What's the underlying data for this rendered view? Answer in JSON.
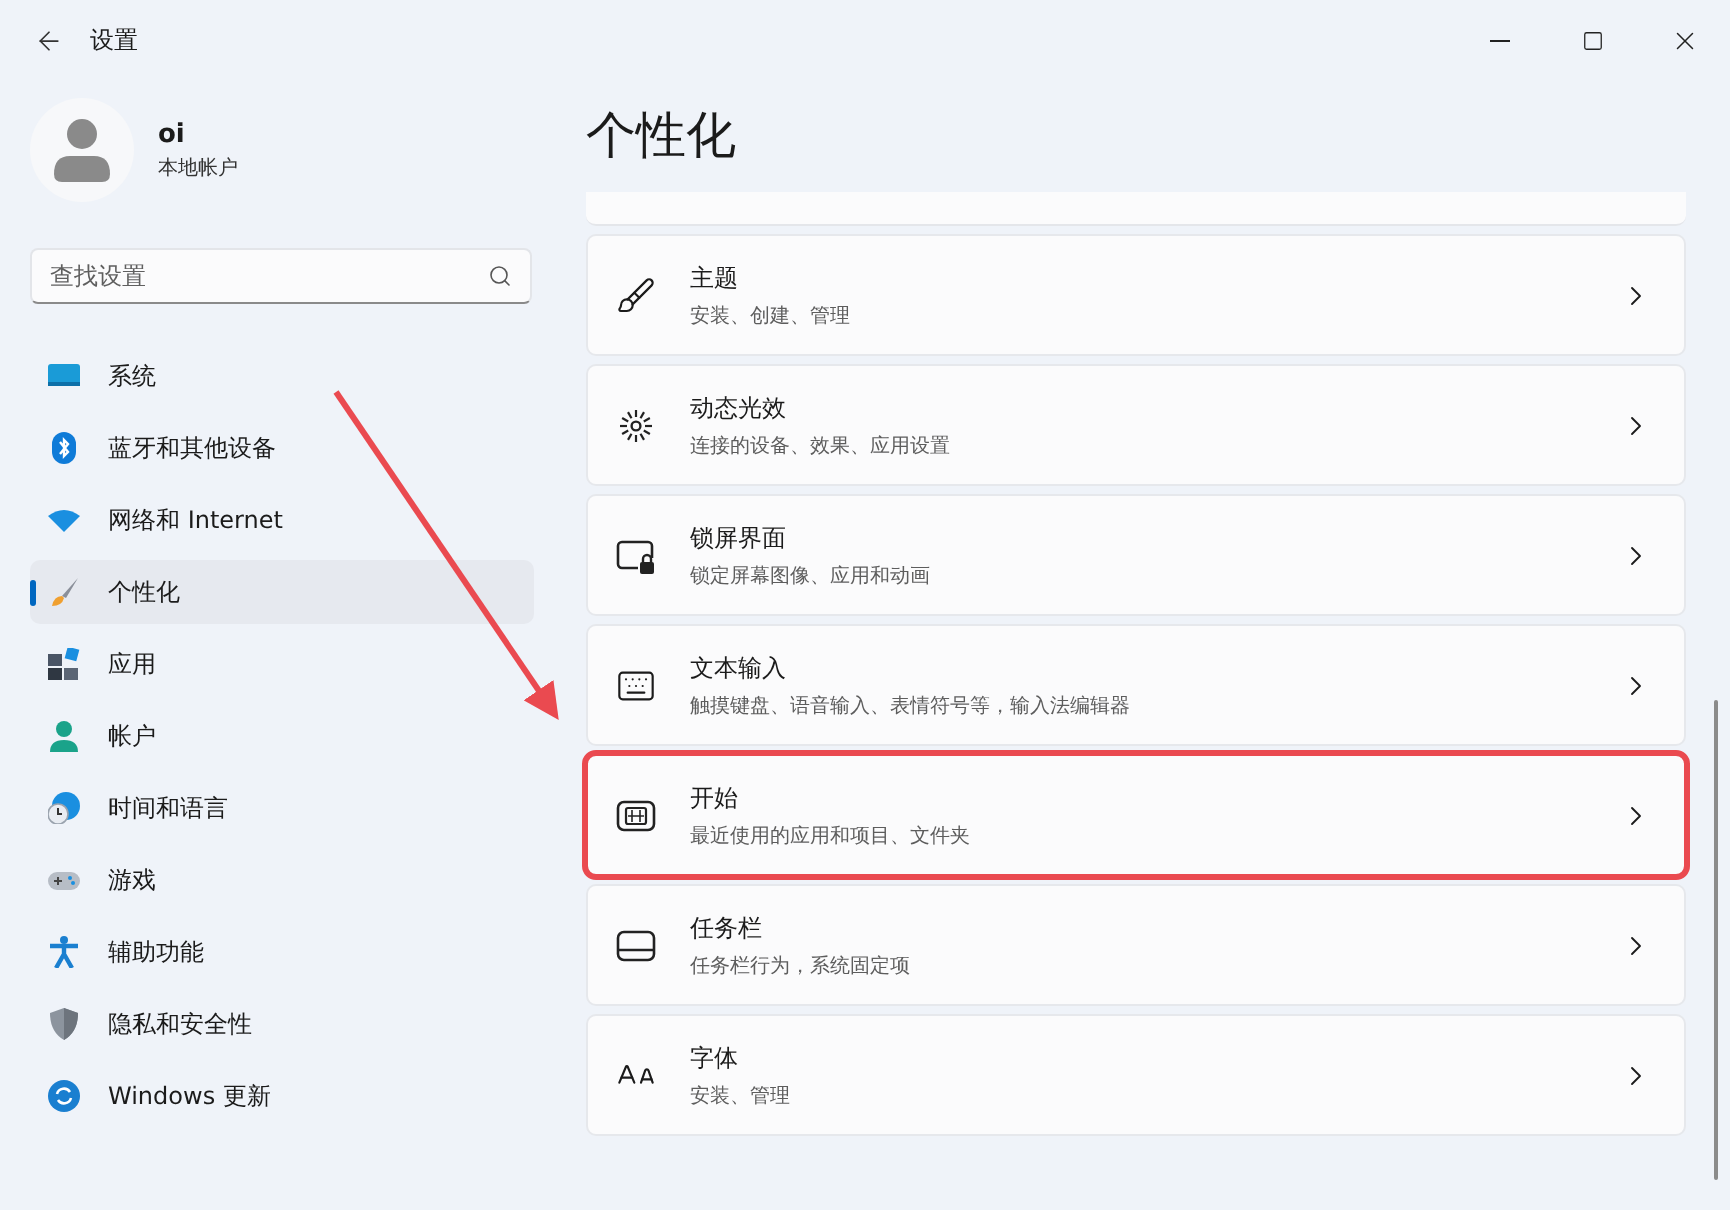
{
  "window": {
    "title": "设置"
  },
  "account": {
    "name": "oi",
    "type": "本地帐户"
  },
  "search": {
    "placeholder": "查找设置"
  },
  "sidebar": {
    "items": [
      {
        "label": "系统",
        "selected": false
      },
      {
        "label": "蓝牙和其他设备",
        "selected": false
      },
      {
        "label": "网络和 Internet",
        "selected": false
      },
      {
        "label": "个性化",
        "selected": true
      },
      {
        "label": "应用",
        "selected": false
      },
      {
        "label": "帐户",
        "selected": false
      },
      {
        "label": "时间和语言",
        "selected": false
      },
      {
        "label": "游戏",
        "selected": false
      },
      {
        "label": "辅助功能",
        "selected": false
      },
      {
        "label": "隐私和安全性",
        "selected": false
      },
      {
        "label": "Windows 更新",
        "selected": false
      }
    ]
  },
  "page": {
    "title": "个性化",
    "cards": [
      {
        "title": "主题",
        "subtitle": "安装、创建、管理",
        "highlighted": false
      },
      {
        "title": "动态光效",
        "subtitle": "连接的设备、效果、应用设置",
        "highlighted": false
      },
      {
        "title": "锁屏界面",
        "subtitle": "锁定屏幕图像、应用和动画",
        "highlighted": false
      },
      {
        "title": "文本输入",
        "subtitle": "触摸键盘、语音输入、表情符号等，输入法编辑器",
        "highlighted": false
      },
      {
        "title": "开始",
        "subtitle": "最近使用的应用和项目、文件夹",
        "highlighted": true
      },
      {
        "title": "任务栏",
        "subtitle": "任务栏行为，系统固定项",
        "highlighted": false
      },
      {
        "title": "字体",
        "subtitle": "安装、管理",
        "highlighted": false
      }
    ]
  }
}
